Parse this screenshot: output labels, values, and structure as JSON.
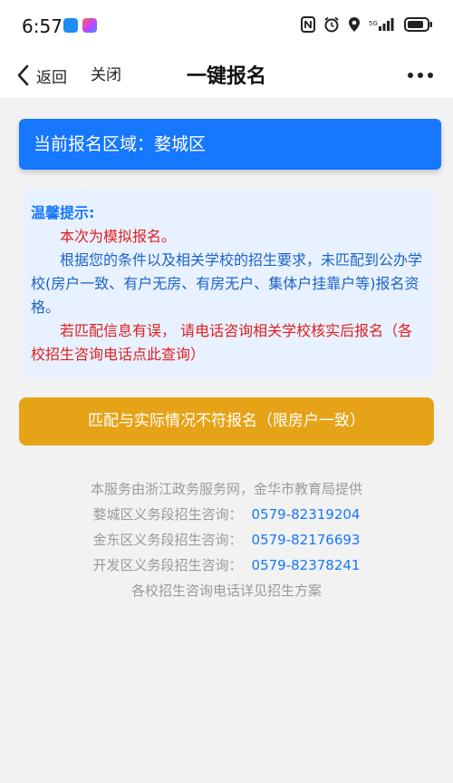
{
  "status_bar": {
    "time": "6:57",
    "icons": [
      "cloud-app-icon",
      "app-store-icon",
      "nfc-icon",
      "alarm-icon",
      "location-icon",
      "signal-icon",
      "battery-icon"
    ],
    "signal_label": "5G"
  },
  "nav": {
    "back_label": "返回",
    "close_label": "关闭",
    "title": "一键报名",
    "more_icon": "more-icon"
  },
  "region": {
    "label": "当前报名区域：婺城区"
  },
  "notice": {
    "title": "温馨提示:",
    "line1": "本次为模拟报名。",
    "line2": "根据您的条件以及相关学校的招生要求，未匹配到公办学校(房户一致、有户无房、有房无户、集体户挂靠户等)报名资格。",
    "line3": "若匹配信息有误， 请电话咨询相关学校核实后报名（各校招生咨询电话点此查询）"
  },
  "action": {
    "mismatch_label": "匹配与实际情况不符报名（限房户一致）"
  },
  "footer": {
    "provider": "本服务由浙江政务服务网，金华市教育局提供",
    "contacts": [
      {
        "label": "婺城区义务段招生咨询：",
        "phone": "0579-82319204"
      },
      {
        "label": "金东区义务段招生咨询：",
        "phone": "0579-82176693"
      },
      {
        "label": "开发区义务段招生咨询：",
        "phone": "0579-82378241"
      }
    ],
    "note": "各校招生咨询电话详见招生方案"
  },
  "colors": {
    "primary_blue": "#1677ff",
    "warning_red": "#e02020",
    "button_orange": "#e6a317",
    "notice_bg": "#e8f1ff"
  }
}
